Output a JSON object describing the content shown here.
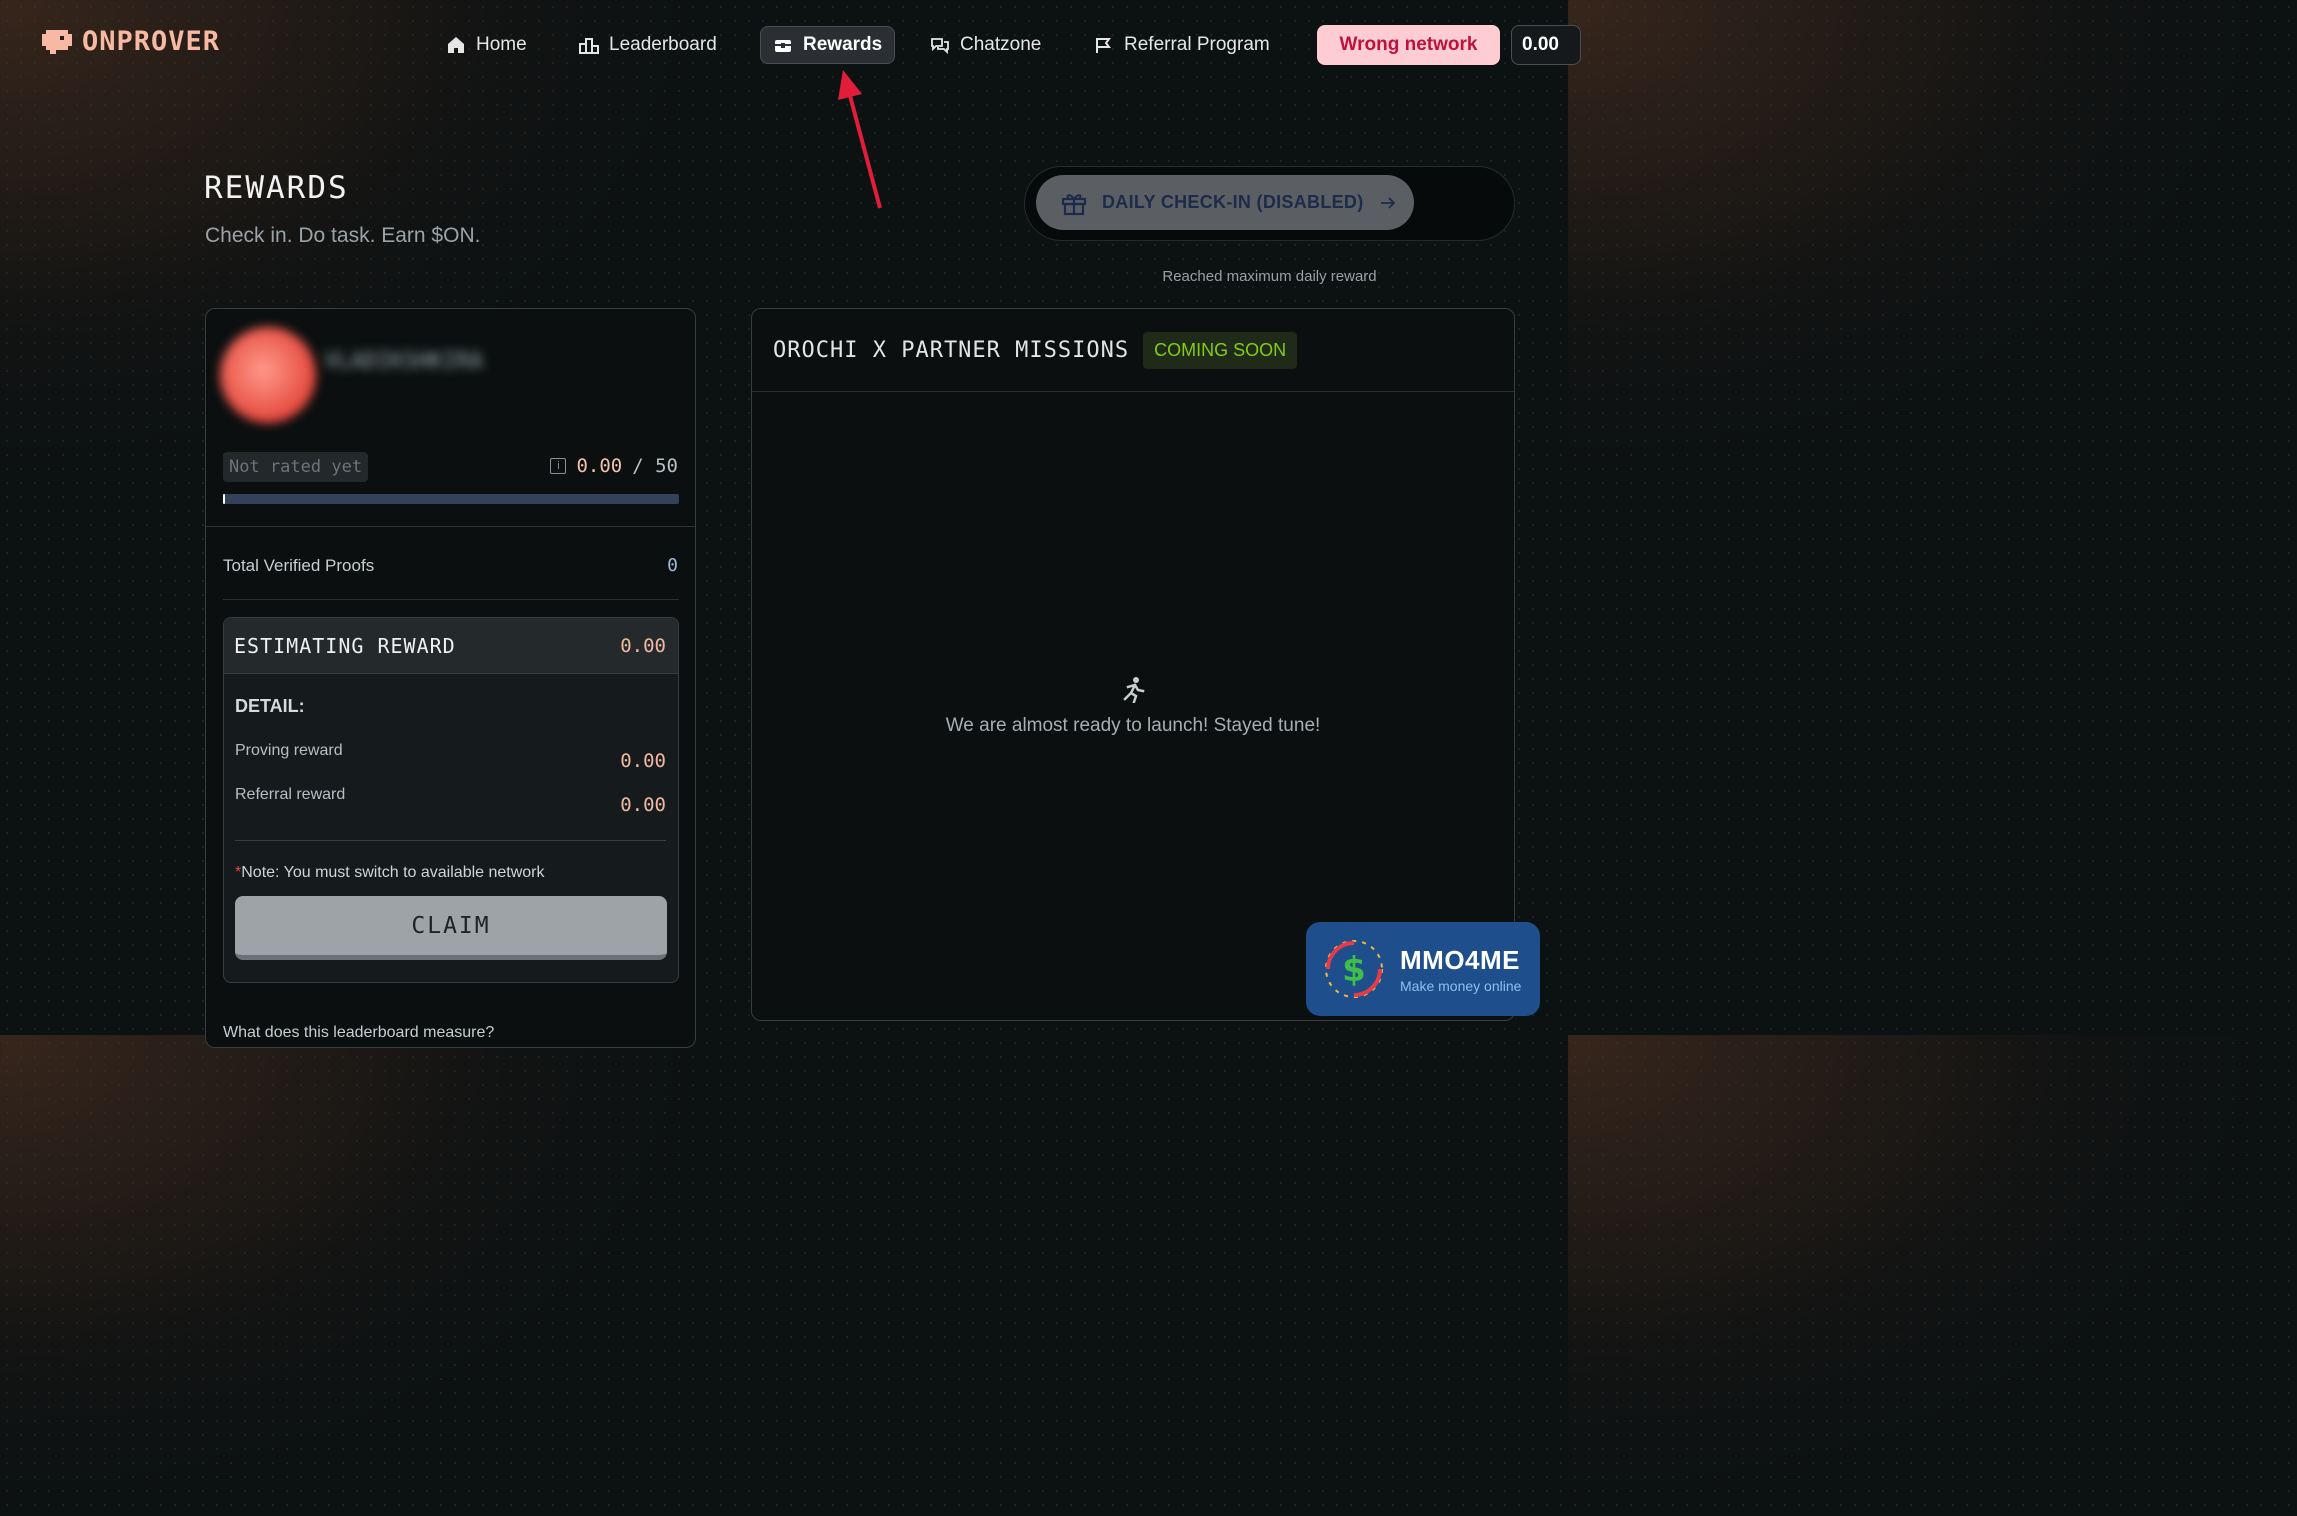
{
  "brand": {
    "name": "ONPROVER",
    "logo_icon": "dino-logo-icon"
  },
  "nav": {
    "items": [
      {
        "label": "Home",
        "icon": "home-icon"
      },
      {
        "label": "Leaderboard",
        "icon": "podium-icon"
      },
      {
        "label": "Rewards",
        "icon": "treasure-chest-icon",
        "active": true
      },
      {
        "label": "Chatzone",
        "icon": "chat-bubbles-icon"
      },
      {
        "label": "Referral Program",
        "icon": "megaphone-icon"
      }
    ],
    "wrong_network_label": "Wrong network",
    "balance": "0.00"
  },
  "header": {
    "title": "REWARDS",
    "subtitle": "Check in. Do task. Earn $ON."
  },
  "checkin": {
    "button_label": "DAILY CHECK-IN (DISABLED)",
    "note": "Reached maximum daily reward",
    "icon": "gift-icon"
  },
  "profile": {
    "username": "VLADIKSHKIRA",
    "rank": "Not rated yet",
    "score": "0.00",
    "score_max": "/ 50",
    "progress": 0.0,
    "total_proofs_label": "Total Verified Proofs",
    "total_proofs_value": "0"
  },
  "estimate": {
    "title": "ESTIMATING REWARD",
    "value": "0.00",
    "detail_title": "DETAIL:",
    "proving_label": "Proving reward",
    "proving_value": "0.00",
    "referral_label": "Referral reward",
    "referral_value": "0.00",
    "note_star": "*",
    "note": "Note: You must switch to available network",
    "claim_label": "CLAIM",
    "faq": "What does this leaderboard measure?"
  },
  "missions": {
    "title": "OROCHI X PARTNER MISSIONS",
    "badge": "COMING SOON",
    "empty_text": "We are almost ready to launch! Stayed tune!",
    "empty_icon": "runner-icon"
  },
  "watermark": {
    "title": "MMO4ME",
    "subtitle": "Make money online"
  },
  "colors": {
    "accent": "#f7b9a3",
    "danger_bg": "#fecdd3",
    "danger_text": "#be123c",
    "coming_soon": "#84cc16"
  }
}
